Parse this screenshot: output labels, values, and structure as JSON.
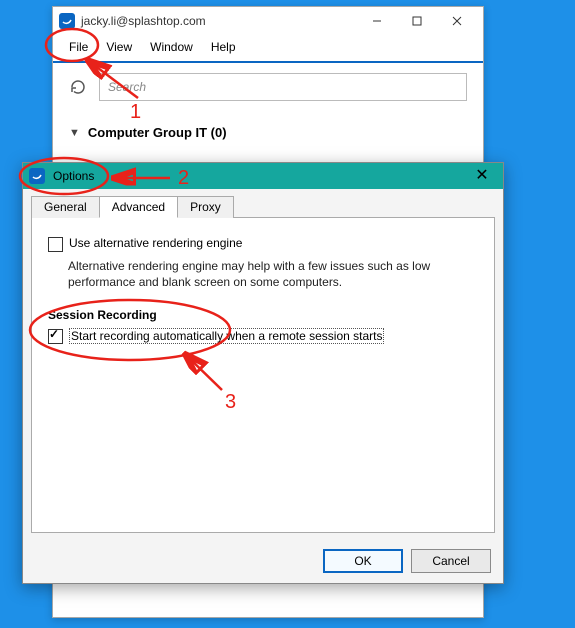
{
  "main": {
    "title": "jacky.li@splashtop.com",
    "menu": {
      "file": "File",
      "view": "View",
      "window": "Window",
      "help": "Help"
    },
    "search_placeholder": "Search",
    "group_label": "Computer Group IT (0)"
  },
  "dialog": {
    "title": "Options",
    "tabs": {
      "general": "General",
      "advanced": "Advanced",
      "proxy": "Proxy"
    },
    "alt_render_label": "Use alternative rendering engine",
    "alt_render_hint": "Alternative rendering engine may help with a few issues such as low performance and blank screen on some computers.",
    "section_title": "Session Recording",
    "auto_record_label": "Start recording automatically when a remote session starts",
    "ok": "OK",
    "cancel": "Cancel"
  },
  "annotations": {
    "n1": "1",
    "n2": "2",
    "n3": "3"
  }
}
